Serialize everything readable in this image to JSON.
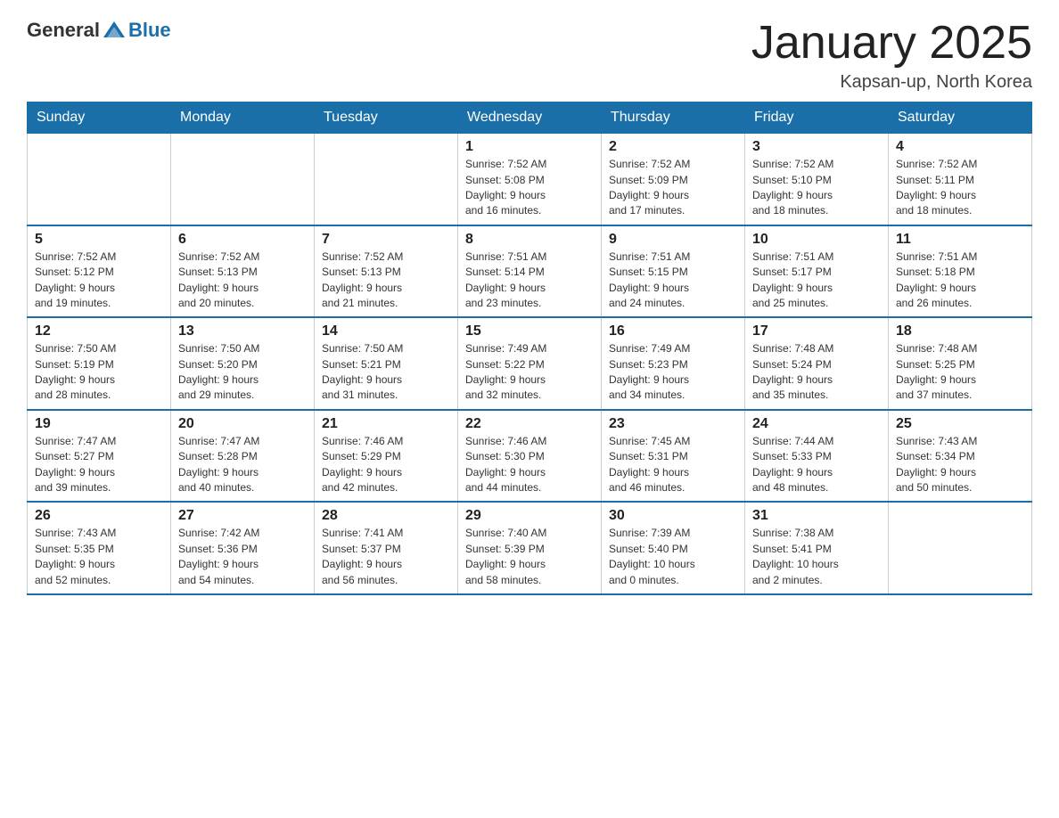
{
  "logo": {
    "text_general": "General",
    "text_blue": "Blue"
  },
  "title": {
    "month_year": "January 2025",
    "location": "Kapsan-up, North Korea"
  },
  "weekdays": [
    "Sunday",
    "Monday",
    "Tuesday",
    "Wednesday",
    "Thursday",
    "Friday",
    "Saturday"
  ],
  "weeks": [
    [
      {
        "day": "",
        "info": ""
      },
      {
        "day": "",
        "info": ""
      },
      {
        "day": "",
        "info": ""
      },
      {
        "day": "1",
        "info": "Sunrise: 7:52 AM\nSunset: 5:08 PM\nDaylight: 9 hours\nand 16 minutes."
      },
      {
        "day": "2",
        "info": "Sunrise: 7:52 AM\nSunset: 5:09 PM\nDaylight: 9 hours\nand 17 minutes."
      },
      {
        "day": "3",
        "info": "Sunrise: 7:52 AM\nSunset: 5:10 PM\nDaylight: 9 hours\nand 18 minutes."
      },
      {
        "day": "4",
        "info": "Sunrise: 7:52 AM\nSunset: 5:11 PM\nDaylight: 9 hours\nand 18 minutes."
      }
    ],
    [
      {
        "day": "5",
        "info": "Sunrise: 7:52 AM\nSunset: 5:12 PM\nDaylight: 9 hours\nand 19 minutes."
      },
      {
        "day": "6",
        "info": "Sunrise: 7:52 AM\nSunset: 5:13 PM\nDaylight: 9 hours\nand 20 minutes."
      },
      {
        "day": "7",
        "info": "Sunrise: 7:52 AM\nSunset: 5:13 PM\nDaylight: 9 hours\nand 21 minutes."
      },
      {
        "day": "8",
        "info": "Sunrise: 7:51 AM\nSunset: 5:14 PM\nDaylight: 9 hours\nand 23 minutes."
      },
      {
        "day": "9",
        "info": "Sunrise: 7:51 AM\nSunset: 5:15 PM\nDaylight: 9 hours\nand 24 minutes."
      },
      {
        "day": "10",
        "info": "Sunrise: 7:51 AM\nSunset: 5:17 PM\nDaylight: 9 hours\nand 25 minutes."
      },
      {
        "day": "11",
        "info": "Sunrise: 7:51 AM\nSunset: 5:18 PM\nDaylight: 9 hours\nand 26 minutes."
      }
    ],
    [
      {
        "day": "12",
        "info": "Sunrise: 7:50 AM\nSunset: 5:19 PM\nDaylight: 9 hours\nand 28 minutes."
      },
      {
        "day": "13",
        "info": "Sunrise: 7:50 AM\nSunset: 5:20 PM\nDaylight: 9 hours\nand 29 minutes."
      },
      {
        "day": "14",
        "info": "Sunrise: 7:50 AM\nSunset: 5:21 PM\nDaylight: 9 hours\nand 31 minutes."
      },
      {
        "day": "15",
        "info": "Sunrise: 7:49 AM\nSunset: 5:22 PM\nDaylight: 9 hours\nand 32 minutes."
      },
      {
        "day": "16",
        "info": "Sunrise: 7:49 AM\nSunset: 5:23 PM\nDaylight: 9 hours\nand 34 minutes."
      },
      {
        "day": "17",
        "info": "Sunrise: 7:48 AM\nSunset: 5:24 PM\nDaylight: 9 hours\nand 35 minutes."
      },
      {
        "day": "18",
        "info": "Sunrise: 7:48 AM\nSunset: 5:25 PM\nDaylight: 9 hours\nand 37 minutes."
      }
    ],
    [
      {
        "day": "19",
        "info": "Sunrise: 7:47 AM\nSunset: 5:27 PM\nDaylight: 9 hours\nand 39 minutes."
      },
      {
        "day": "20",
        "info": "Sunrise: 7:47 AM\nSunset: 5:28 PM\nDaylight: 9 hours\nand 40 minutes."
      },
      {
        "day": "21",
        "info": "Sunrise: 7:46 AM\nSunset: 5:29 PM\nDaylight: 9 hours\nand 42 minutes."
      },
      {
        "day": "22",
        "info": "Sunrise: 7:46 AM\nSunset: 5:30 PM\nDaylight: 9 hours\nand 44 minutes."
      },
      {
        "day": "23",
        "info": "Sunrise: 7:45 AM\nSunset: 5:31 PM\nDaylight: 9 hours\nand 46 minutes."
      },
      {
        "day": "24",
        "info": "Sunrise: 7:44 AM\nSunset: 5:33 PM\nDaylight: 9 hours\nand 48 minutes."
      },
      {
        "day": "25",
        "info": "Sunrise: 7:43 AM\nSunset: 5:34 PM\nDaylight: 9 hours\nand 50 minutes."
      }
    ],
    [
      {
        "day": "26",
        "info": "Sunrise: 7:43 AM\nSunset: 5:35 PM\nDaylight: 9 hours\nand 52 minutes."
      },
      {
        "day": "27",
        "info": "Sunrise: 7:42 AM\nSunset: 5:36 PM\nDaylight: 9 hours\nand 54 minutes."
      },
      {
        "day": "28",
        "info": "Sunrise: 7:41 AM\nSunset: 5:37 PM\nDaylight: 9 hours\nand 56 minutes."
      },
      {
        "day": "29",
        "info": "Sunrise: 7:40 AM\nSunset: 5:39 PM\nDaylight: 9 hours\nand 58 minutes."
      },
      {
        "day": "30",
        "info": "Sunrise: 7:39 AM\nSunset: 5:40 PM\nDaylight: 10 hours\nand 0 minutes."
      },
      {
        "day": "31",
        "info": "Sunrise: 7:38 AM\nSunset: 5:41 PM\nDaylight: 10 hours\nand 2 minutes."
      },
      {
        "day": "",
        "info": ""
      }
    ]
  ]
}
